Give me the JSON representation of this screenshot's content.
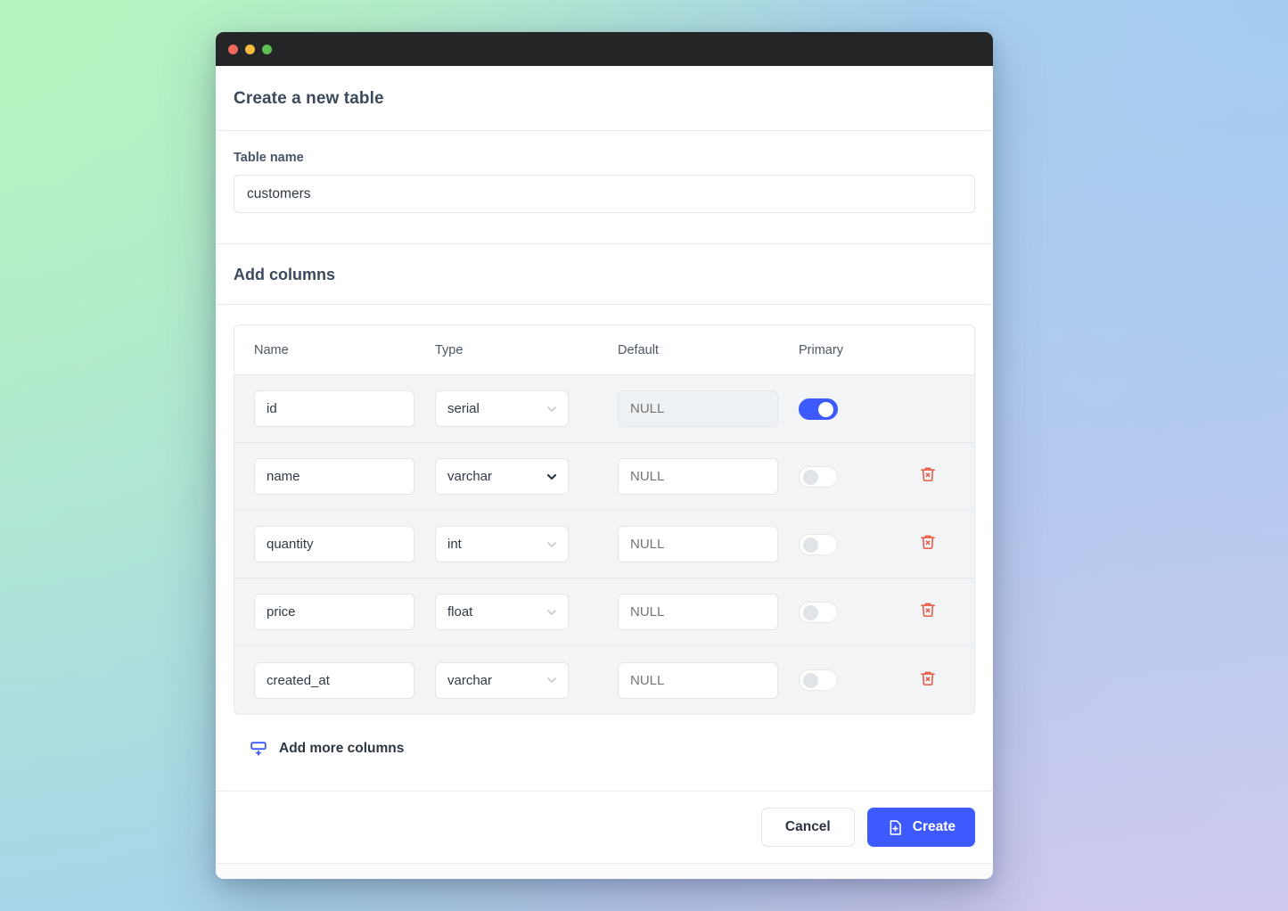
{
  "window": {
    "traffic_lights": [
      "close",
      "minimize",
      "zoom"
    ],
    "colors": {
      "accent": "#3d5afe",
      "danger": "#e8553f",
      "titlebar": "#242527",
      "row_bg": "#f2f4f6"
    }
  },
  "modal": {
    "title": "Create a new table",
    "table_name": {
      "label": "Table name",
      "value": "customers",
      "placeholder": "Table name"
    },
    "columns_section": {
      "title": "Add columns",
      "headers": [
        "Name",
        "Type",
        "Default",
        "Primary"
      ],
      "rows": [
        {
          "name": "id",
          "type": "serial",
          "default_placeholder": "NULL",
          "default_value": "",
          "primary": true,
          "default_disabled": true,
          "deletable": false,
          "type_chevron": "light"
        },
        {
          "name": "name",
          "type": "varchar",
          "default_placeholder": "NULL",
          "default_value": "",
          "primary": false,
          "default_disabled": false,
          "deletable": true,
          "type_chevron": "strong"
        },
        {
          "name": "quantity",
          "type": "int",
          "default_placeholder": "NULL",
          "default_value": "",
          "primary": false,
          "default_disabled": false,
          "deletable": true,
          "type_chevron": "light"
        },
        {
          "name": "price",
          "type": "float",
          "default_placeholder": "NULL",
          "default_value": "",
          "primary": false,
          "default_disabled": false,
          "deletable": true,
          "type_chevron": "light"
        },
        {
          "name": "created_at",
          "type": "varchar",
          "default_placeholder": "NULL",
          "default_value": "",
          "primary": false,
          "default_disabled": false,
          "deletable": true,
          "type_chevron": "light"
        }
      ],
      "add_more_label": "Add more columns",
      "add_more_icon": "add-row-icon",
      "delete_icon": "trash-icon"
    },
    "footer": {
      "cancel_label": "Cancel",
      "create_label": "Create",
      "create_icon": "document-plus-icon"
    }
  }
}
